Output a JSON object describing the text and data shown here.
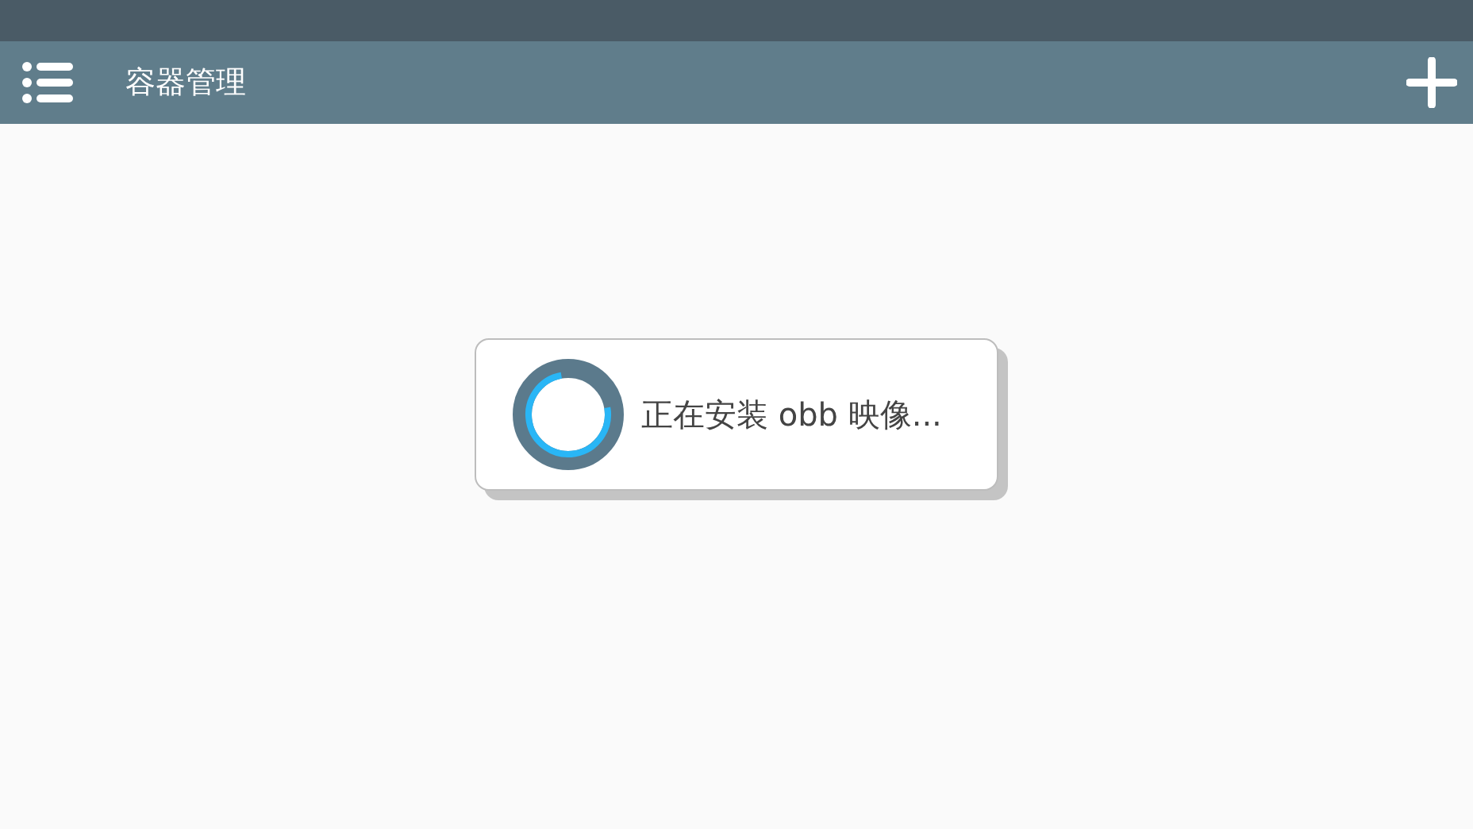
{
  "app_bar": {
    "title": "容器管理"
  },
  "progress_dialog": {
    "message": "正在安装 obb 映像..."
  }
}
